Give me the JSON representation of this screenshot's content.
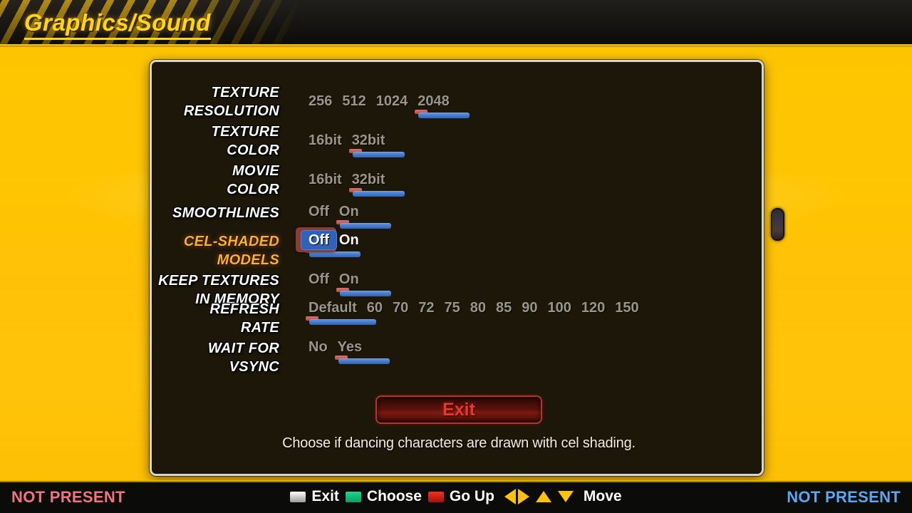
{
  "header": {
    "title": "Graphics/Sound"
  },
  "panel": {
    "settings": [
      {
        "label": "TEXTURE\nRESOLUTION",
        "options": [
          "256",
          "512",
          "1024",
          "2048"
        ],
        "selected_index": 3,
        "selected": false
      },
      {
        "label": "TEXTURE\nCOLOR",
        "options": [
          "16bit",
          "32bit"
        ],
        "selected_index": 1,
        "selected": false
      },
      {
        "label": "MOVIE\nCOLOR",
        "options": [
          "16bit",
          "32bit"
        ],
        "selected_index": 1,
        "selected": false
      },
      {
        "label": "SMOOTHLINES",
        "options": [
          "Off",
          "On"
        ],
        "selected_index": 1,
        "selected": false
      },
      {
        "label": "CEL-SHADED\nMODELS",
        "options": [
          "Off",
          "On"
        ],
        "selected_index": 0,
        "selected": true
      },
      {
        "label": "KEEP TEXTURES\nIN MEMORY",
        "options": [
          "Off",
          "On"
        ],
        "selected_index": 1,
        "selected": false
      },
      {
        "label": "REFRESH\nRATE",
        "options": [
          "Default",
          "60",
          "70",
          "72",
          "75",
          "80",
          "85",
          "90",
          "100",
          "120",
          "150"
        ],
        "selected_index": 0,
        "selected": false
      },
      {
        "label": "WAIT FOR\nVSYNC",
        "options": [
          "No",
          "Yes"
        ],
        "selected_index": 1,
        "selected": false
      }
    ],
    "exit_label": "Exit",
    "help_text": "Choose if dancing characters are drawn with cel shading."
  },
  "footer": {
    "left_status": "NOT PRESENT",
    "right_status": "NOT PRESENT",
    "hints": [
      {
        "icon": "white-square-button-icon",
        "label": "Exit"
      },
      {
        "icon": "green-square-button-icon",
        "label": "Choose"
      },
      {
        "icon": "red-square-button-icon",
        "label": "Go Up"
      }
    ],
    "move_label": "Move",
    "move_icons": [
      "arrow-left-icon",
      "arrow-right-icon",
      "arrow-up-icon",
      "arrow-down-icon"
    ]
  },
  "colors": {
    "accent_yellow": "#ffc107",
    "header_title": "#ffd519",
    "panel_bg": "#1d1709",
    "selected_label": "#ffb028",
    "highlight_blue": "#2f62b8",
    "highlight_red": "#8e3b33",
    "exit_red": "#e8392e",
    "status_left": "#f0737f",
    "status_right": "#5aa7f0"
  }
}
